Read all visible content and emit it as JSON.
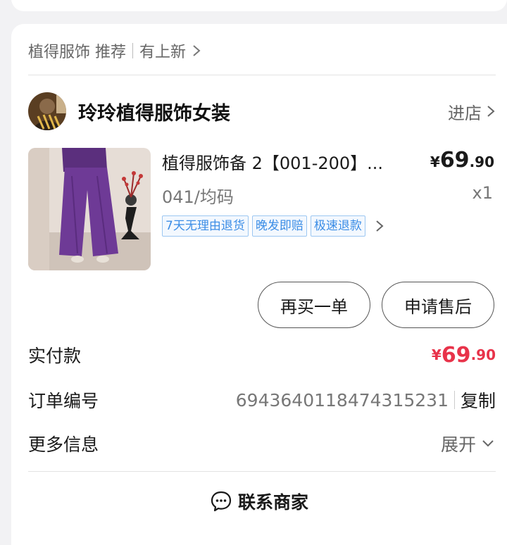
{
  "recommend": {
    "label": "植得服饰 推荐",
    "new_label": "有上新"
  },
  "shop": {
    "name": "玲玲植得服饰女装",
    "enter_label": "进店"
  },
  "product": {
    "title": "植得服饰备 2【001-200】...",
    "price_currency": "¥",
    "price_int": "69",
    "price_dec": ".90",
    "spec": "041/均码",
    "qty": "x1",
    "tags": [
      "7天无理由退货",
      "晚发即赔",
      "极速退款"
    ]
  },
  "actions": {
    "rebuy": "再买一单",
    "aftersale": "申请售后"
  },
  "payment": {
    "label": "实付款",
    "currency": "¥",
    "int": "69",
    "dec": ".90"
  },
  "order": {
    "label": "订单编号",
    "number": "6943640118474315231",
    "copy": "复制"
  },
  "more_info": {
    "label": "更多信息",
    "expand": "展开"
  },
  "contact": {
    "label": "联系商家"
  },
  "colors": {
    "accent_red": "#e8334a",
    "tag_blue": "#3b8de6"
  }
}
